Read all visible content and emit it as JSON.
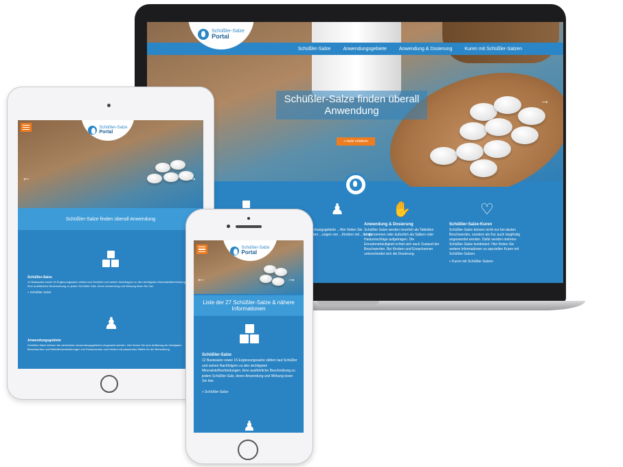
{
  "brand": {
    "line1": "Schüßler-Salze",
    "line2": "Portal"
  },
  "laptop": {
    "nav": [
      "Schüßler-Salze",
      "Anwendungsgebiete",
      "Anwendung & Dosierung",
      "Kuren mit Schüßler-Salzen"
    ],
    "hero_heading": "Schüßler-Salze finden überall Anwendung",
    "more_button": "» mehr erfahren",
    "arrow_right": "→",
    "columns": [
      {
        "icon": "boxes-icon",
        "title": "",
        "text": "",
        "link": ""
      },
      {
        "icon": "person-dog-icon",
        "title": "...iete",
        "text": "...n bei ...chungsgebiete ...Hier finden Sie ...häufigsten ...ungen von ...Kindern mit ...für die",
        "link": ""
      },
      {
        "icon": "hand-pills-icon",
        "title": "Anwendung & Dosierung",
        "text": "Schüßler-Salze werden innerlich als Tabletten eingenommen oder äußerlich als Salben oder Hautumschläge aufgetragen. Die Einnahmehäufigkeit richtet sich nach Zustand der Beschwerden. Bei Kindern und Erwachsenen unterscheidet sich die Dosierung.",
        "link": ""
      },
      {
        "icon": "hand-care-icon",
        "title": "Schüßler-Salze-Kuren",
        "text": "Schüßler-Salze können nicht nur bei akuten Beschwerden, sondern als Kur auch langfristig angewendet werden. Dafür werden mehrere Schüßler-Salze kombiniert. Hier finden Sie weitere Informationen zu speziellen Kuren mit Schüßler-Salzen.",
        "link": "» Kuren mit Schüßler-Salzen"
      }
    ]
  },
  "tablet": {
    "heading": "Schüßler-Salze finden überall Anwendung",
    "arrow_left": "←",
    "arrow_right": "→",
    "block1": {
      "title": "Schüßler-Salze",
      "text": "12 Basissalze sowie 15 Ergänzungssalze zählen laut Schüßler und seinen Nachfolgern zu den wichtigsten Mineralstoffverbindungen. Eine ausführliche Beschreibung zu jedem Schüßler-Salz, deren Anwendung und Wirkung lesen Sie hier.",
      "link": "» Schüßler-Salze"
    },
    "block2": {
      "title": "Anwendungsgebiete",
      "text": "Schüßler-Salze können bei zahlreichen Anwendungsgebieten eingesetzt werden. Hier finden Sie eine Auflistung der häufigsten Beschwerden und Befindlichkeitsstörungen von Erwachsenen und Kindern mit passenden Mitteln für die Behandlung."
    }
  },
  "phone": {
    "heading": "Liste der 27 Schüßler-Salze & nähere Informationen",
    "arrow_left": "←",
    "arrow_right": "→",
    "block": {
      "title": "Schüßler-Salze",
      "text": "12 Basissalze sowie 15 Ergänzungssalze zählen laut Schüßler und seinen Nachfolgern zu den wichtigsten Mineralstoffverbindungen. Eine ausführliche Beschreibung zu jedem Schüßler-Salz, deren Anwendung und Wirkung lesen Sie hier.",
      "link": "» Schüßler-Salze"
    }
  },
  "colors": {
    "primary_blue": "#2a83c2",
    "light_blue": "#3d9bd8",
    "accent_orange": "#ee7d22"
  }
}
